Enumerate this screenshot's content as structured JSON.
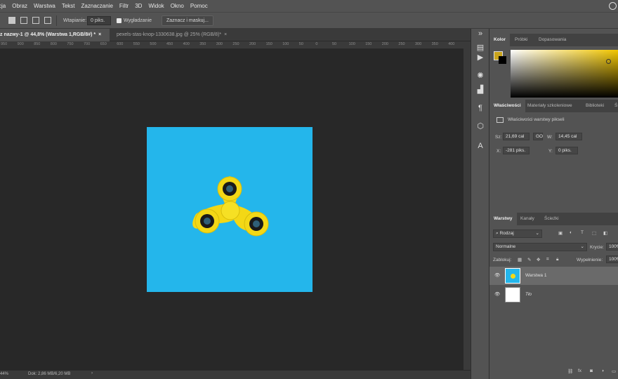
{
  "menubar": {
    "items": [
      "cja",
      "Obraz",
      "Warstwa",
      "Tekst",
      "Zaznaczanie",
      "Filtr",
      "3D",
      "Widok",
      "Okno",
      "Pomoc"
    ]
  },
  "options": {
    "feather_label": "Wtapianie:",
    "feather_value": "0 piks.",
    "antialias_label": "Wygładzanie",
    "select_mask_button": "Zaznacz i maskuj..."
  },
  "tabs": [
    {
      "label": "z nazwy-1 @ 44,8% (Warstwa 1,RGB/8#) *",
      "close": "×"
    },
    {
      "label": "pexels-stas-knop-1330638.jpg @ 25% (RGB/8)*",
      "close": "×"
    }
  ],
  "ruler": {
    "ticks": [
      "950",
      "900",
      "850",
      "800",
      "750",
      "700",
      "650",
      "600",
      "550",
      "500",
      "450",
      "400",
      "350",
      "300",
      "250",
      "200",
      "150",
      "100",
      "50",
      "0",
      "50",
      "100",
      "150",
      "200",
      "250",
      "300",
      "350",
      "400",
      "450",
      "500",
      "550",
      "600",
      "650",
      "700",
      "750"
    ]
  },
  "status": {
    "zoom": "44%",
    "doc": "Dok: 2,86 MB/6,20 MB"
  },
  "color_panel": {
    "tabs": [
      "Kolor",
      "Próbki",
      "Dopasowania"
    ],
    "foreground_color": "#c9a31b",
    "background_color": "#000000",
    "hue_color": "#f2c600"
  },
  "properties_panel": {
    "tabs": [
      "Właściwości",
      "Materiały szkoleniowe",
      "Biblioteki",
      "Ś"
    ],
    "title": "Właściwości warstwy pikseli",
    "w_label": "Sz:",
    "w_value": "21,69 cal",
    "link_label": "GO",
    "h_label": "W:",
    "h_value": "14,45 cal",
    "x_label": "X:",
    "x_value": "-281 piks.",
    "y_label": "Y:",
    "y_value": "0 piks."
  },
  "layers_panel": {
    "tabs": [
      "Warstwy",
      "Kanały",
      "Ścieżki"
    ],
    "filter_kind": "Rodzaj",
    "blend_mode": "Normalne",
    "opacity_label": "Krycie:",
    "opacity_value": "100%",
    "lock_label": "Zablokuj:",
    "fill_label": "Wypełnienie:",
    "fill_value": "100%",
    "layers": [
      {
        "name": "Warstwa 1",
        "selected": true,
        "visible": true
      },
      {
        "name": "Tło",
        "selected": false,
        "visible": true
      }
    ]
  },
  "image": {
    "background_color": "#24b6eb",
    "spinner_color": "#f3d816"
  }
}
